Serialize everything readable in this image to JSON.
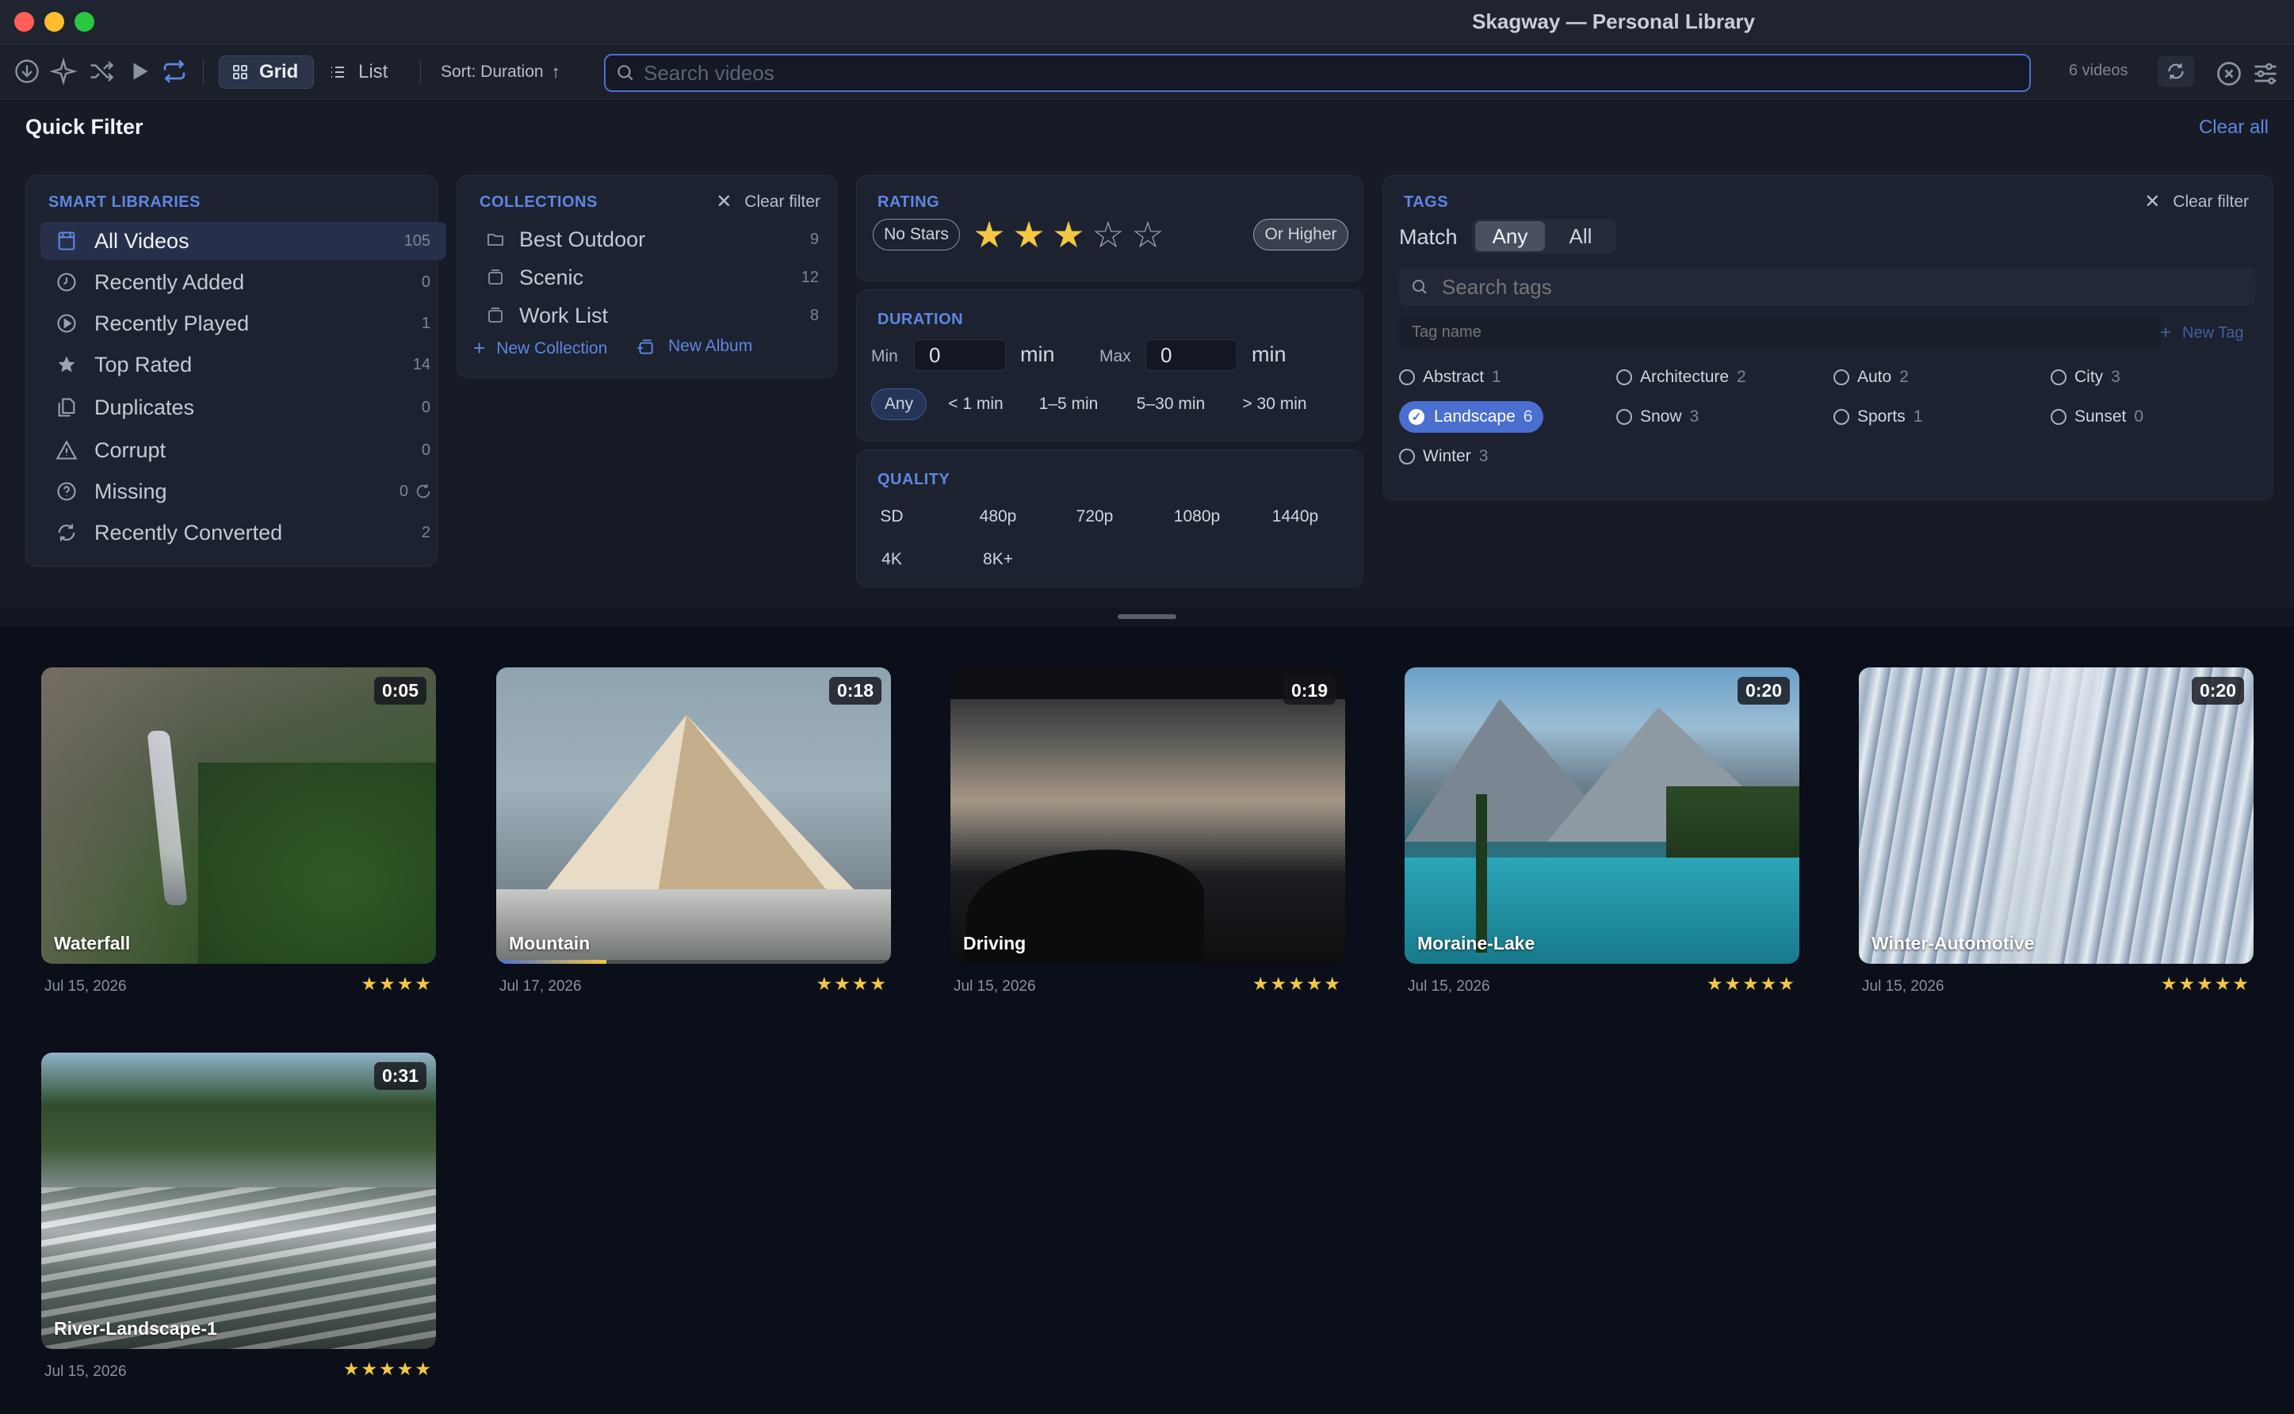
{
  "window": {
    "title": "Skagway — Personal Library"
  },
  "toolbar": {
    "grid_label": "Grid",
    "list_label": "List",
    "sort_label": "Sort: Duration",
    "search_placeholder": "Search videos",
    "video_count": "6 videos"
  },
  "quick_filter": {
    "title": "Quick Filter",
    "clear_all": "Clear all",
    "smart_libraries": {
      "title": "SMART LIBRARIES",
      "items": [
        {
          "label": "All Videos",
          "count": "105",
          "icon": "library-icon",
          "selected": true
        },
        {
          "label": "Recently Added",
          "count": "0",
          "icon": "clock-icon"
        },
        {
          "label": "Recently Played",
          "count": "1",
          "icon": "play-circle-icon"
        },
        {
          "label": "Top Rated",
          "count": "14",
          "icon": "star-icon"
        },
        {
          "label": "Duplicates",
          "count": "0",
          "icon": "duplicate-icon"
        },
        {
          "label": "Corrupt",
          "count": "0",
          "icon": "warning-icon"
        },
        {
          "label": "Missing",
          "count": "0",
          "icon": "question-icon"
        },
        {
          "label": "Recently Converted",
          "count": "2",
          "icon": "convert-icon"
        }
      ]
    },
    "collections": {
      "title": "COLLECTIONS",
      "clear_filter": "Clear filter",
      "items": [
        {
          "label": "Best Outdoor",
          "count": "9"
        },
        {
          "label": "Scenic",
          "count": "12"
        },
        {
          "label": "Work List",
          "count": "8"
        }
      ],
      "new_collection": "New Collection",
      "new_album": "New Album"
    },
    "rating": {
      "title": "RATING",
      "no_stars": "No Stars",
      "value": 3,
      "max": 5,
      "or_higher": "Or Higher"
    },
    "duration": {
      "title": "DURATION",
      "min_label": "Min",
      "min_value": "0",
      "max_label": "Max",
      "max_value": "0",
      "unit": "min",
      "presets": [
        "Any",
        "< 1 min",
        "1–5 min",
        "5–30 min",
        "> 30 min"
      ],
      "selected": "Any"
    },
    "quality": {
      "title": "QUALITY",
      "options": [
        "SD",
        "480p",
        "720p",
        "1080p",
        "1440p",
        "4K",
        "8K+"
      ]
    },
    "tags": {
      "title": "TAGS",
      "clear_filter": "Clear filter",
      "match_label": "Match",
      "match_any": "Any",
      "match_all": "All",
      "search_placeholder": "Search tags",
      "tag_name_placeholder": "Tag name",
      "new_tag": "New Tag",
      "items": [
        {
          "label": "Abstract",
          "count": "1"
        },
        {
          "label": "Architecture",
          "count": "2"
        },
        {
          "label": "Auto",
          "count": "2"
        },
        {
          "label": "City",
          "count": "3"
        },
        {
          "label": "Landscape",
          "count": "6",
          "selected": true
        },
        {
          "label": "Snow",
          "count": "3"
        },
        {
          "label": "Sports",
          "count": "1"
        },
        {
          "label": "Sunset",
          "count": "0"
        },
        {
          "label": "Winter",
          "count": "3"
        }
      ]
    }
  },
  "videos": [
    {
      "name": "Waterfall",
      "duration": "0:05",
      "date": "Jul 15, 2026",
      "stars": 4
    },
    {
      "name": "Mountain",
      "duration": "0:18",
      "date": "Jul 17, 2026",
      "stars": 4,
      "progress": 0.28
    },
    {
      "name": "Driving",
      "duration": "0:19",
      "date": "Jul 15, 2026",
      "stars": 5
    },
    {
      "name": "Moraine-Lake",
      "duration": "0:20",
      "date": "Jul 15, 2026",
      "stars": 5
    },
    {
      "name": "Winter-Automotive",
      "duration": "0:20",
      "date": "Jul 15, 2026",
      "stars": 5
    },
    {
      "name": "River-Landscape-1",
      "duration": "0:31",
      "date": "Jul 15, 2026",
      "stars": 5
    }
  ],
  "colors": {
    "accent": "#4a6fd0",
    "star": "#f2c744",
    "background": "#0a0f19"
  }
}
